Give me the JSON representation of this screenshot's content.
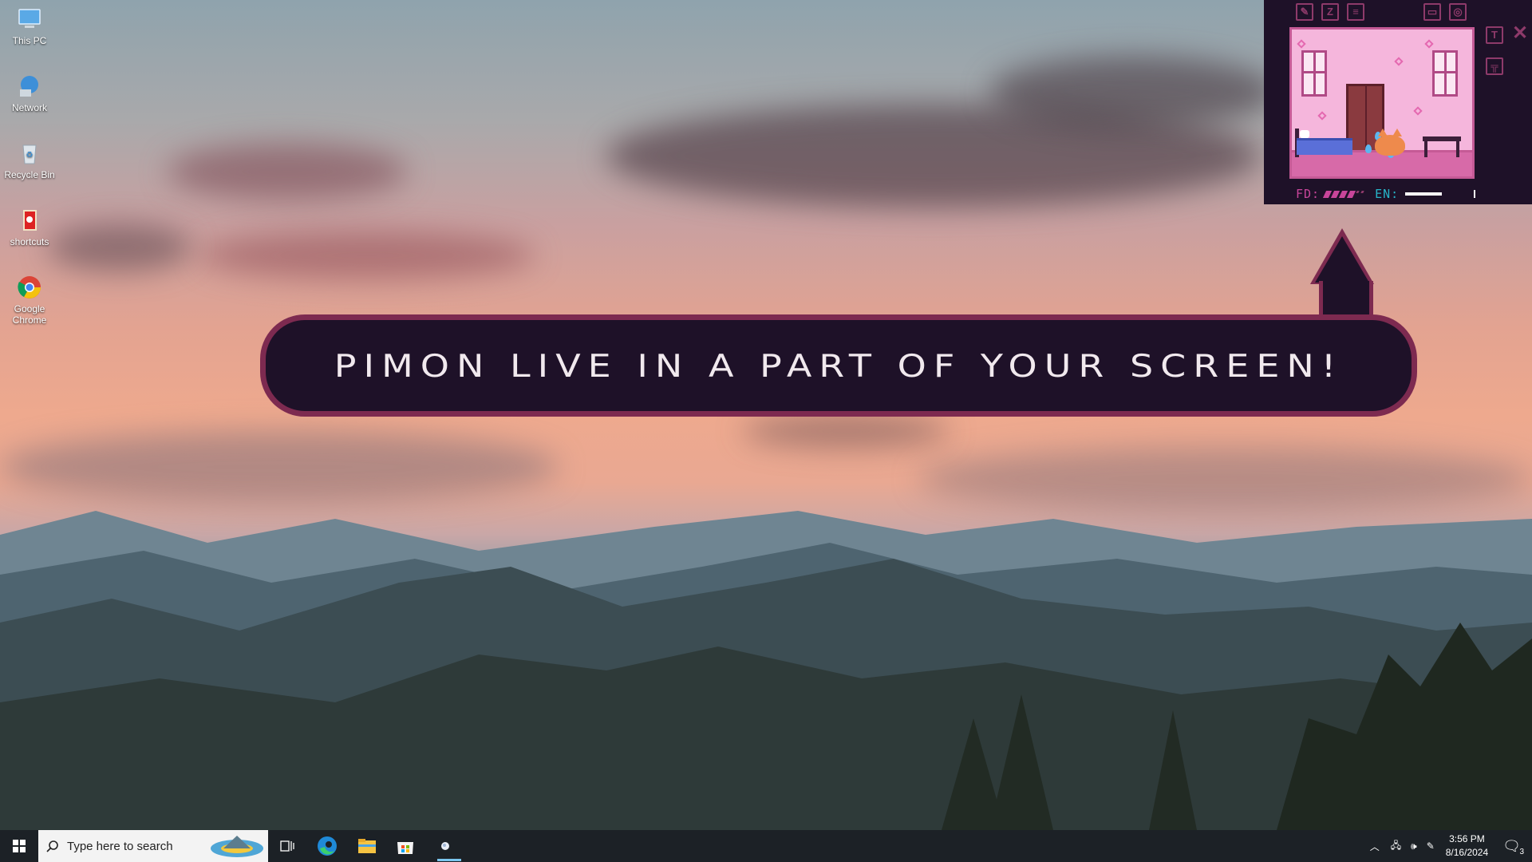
{
  "desktop": {
    "icons": [
      {
        "label": "This PC",
        "icon": "this-pc-icon"
      },
      {
        "label": "Network",
        "icon": "network-icon"
      },
      {
        "label": "Recycle Bin",
        "icon": "recycle-bin-icon"
      },
      {
        "label": "shortcuts",
        "icon": "shortcuts-folder-icon"
      },
      {
        "label": "Google Chrome",
        "icon": "chrome-icon"
      }
    ]
  },
  "banner": {
    "text": "Pimon live in a part of your screen!"
  },
  "widget": {
    "toolbar_icons": [
      "edit-icon",
      "sleep-icon",
      "notes-icon",
      "window-mode-icon",
      "settings-icon"
    ],
    "side_icons": [
      "text-icon",
      "layout-icon"
    ],
    "close_icon": "close-icon",
    "stats": {
      "fd_label": "FD:",
      "fd_level": 4,
      "fd_max": 6,
      "en_label": "EN:"
    },
    "colors": {
      "background": "#1e1128",
      "accent": "#8e3a6a",
      "fd": "#c8459a",
      "en": "#27b4c8"
    }
  },
  "taskbar": {
    "search_placeholder": "Type here to search",
    "apps": [
      "task-view-icon",
      "edge-icon",
      "file-explorer-icon",
      "microsoft-store-icon",
      "pimon-app-icon"
    ],
    "tray": {
      "time": "3:56 PM",
      "date": "8/16/2024",
      "notification_count": "3"
    }
  }
}
